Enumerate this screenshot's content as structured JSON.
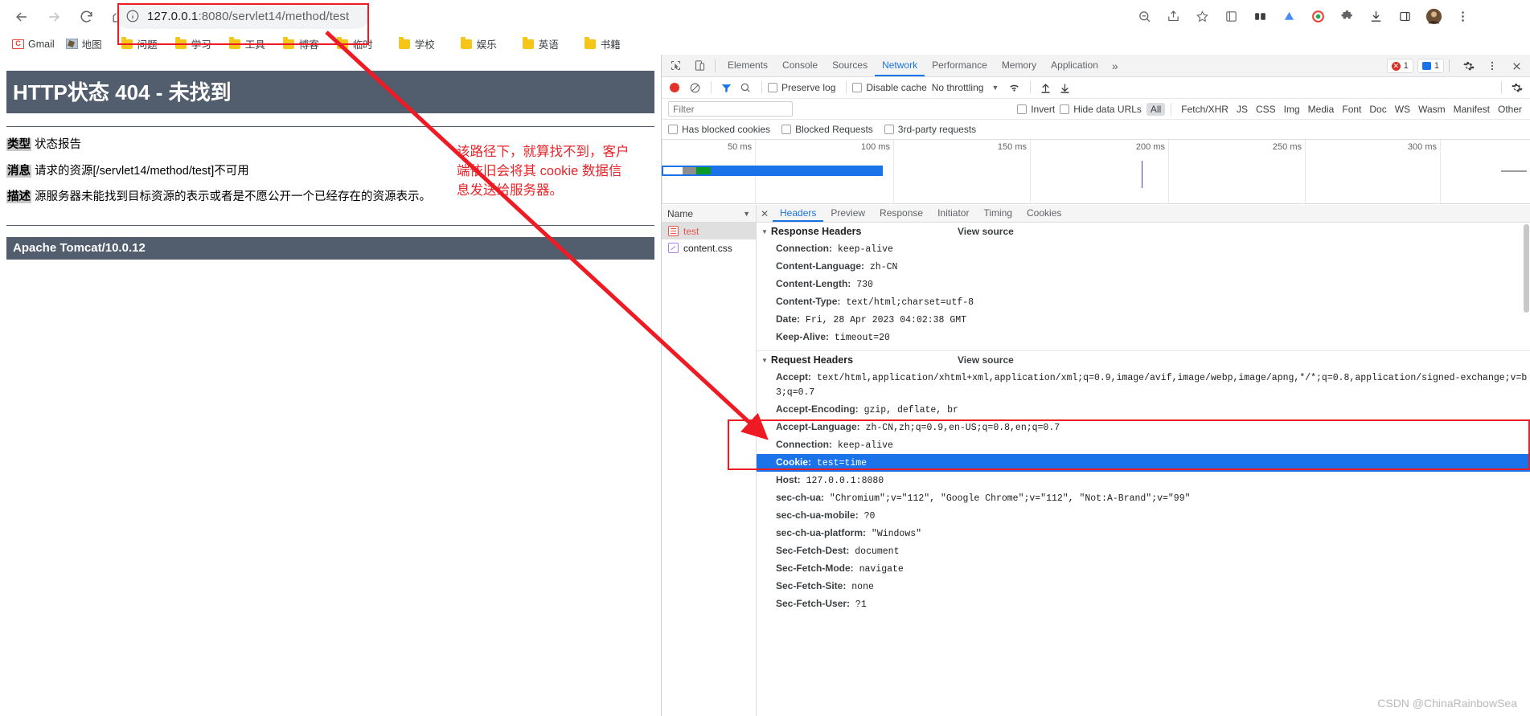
{
  "browser": {
    "nav": {
      "back": "back-arrow",
      "forward": "forward-arrow",
      "reload": "reload",
      "home": "home"
    },
    "omnibox": {
      "host": "127.0.0.1",
      "port": ":8080",
      "path": "/servlet14/method/test",
      "full_url": "127.0.0.1:8080/servlet14/method/test",
      "site_info_icon": "info-circle-icon"
    },
    "toolbar_icons": [
      "zoom-icon",
      "share-icon",
      "bookmark-star-icon",
      "reading-list-icon",
      "extension-grid-icon",
      "cloud-icon",
      "circle-icon",
      "puzzle-icon",
      "download-icon",
      "sidepanel-icon",
      "profile-avatar",
      "three-dot-menu-icon"
    ],
    "bookmarks": [
      {
        "label": "Gmail",
        "icon": "gmail-icon"
      },
      {
        "label": "地图",
        "icon": "map-icon"
      },
      {
        "label": "问题",
        "icon": "folder-icon"
      },
      {
        "label": "学习",
        "icon": "folder-icon"
      },
      {
        "label": "工具",
        "icon": "folder-icon"
      },
      {
        "label": "博客",
        "icon": "folder-icon"
      },
      {
        "label": "临时",
        "icon": "folder-icon"
      },
      {
        "label": "学校",
        "icon": "folder-icon"
      },
      {
        "label": "娱乐",
        "icon": "folder-icon"
      },
      {
        "label": "英语",
        "icon": "folder-icon"
      },
      {
        "label": "书籍",
        "icon": "folder-icon"
      }
    ]
  },
  "page": {
    "title": "HTTP状态 404 - 未找到",
    "rows": [
      {
        "label": "类型",
        "text": " 状态报告"
      },
      {
        "label": "消息",
        "text": " 请求的资源[/servlet14/method/test]不可用"
      },
      {
        "label": "描述",
        "text": " 源服务器未能找到目标资源的表示或者是不愿公开一个已经存在的资源表示。"
      }
    ],
    "footer": "Apache Tomcat/10.0.12"
  },
  "annotation": {
    "text": "该路径下，就算找不到，客户端依旧会将其 cookie 数据信息发送给服务器。",
    "color": "#e8252a"
  },
  "devtools": {
    "tabs": [
      {
        "label": "Elements",
        "active": false
      },
      {
        "label": "Console",
        "active": false
      },
      {
        "label": "Sources",
        "active": false
      },
      {
        "label": "Network",
        "active": true
      },
      {
        "label": "Performance",
        "active": false
      },
      {
        "label": "Memory",
        "active": false
      },
      {
        "label": "Application",
        "active": false
      }
    ],
    "more_tabs": "»",
    "error_count": "1",
    "message_count": "1",
    "settings_icon": "gear-icon",
    "menu_icon": "three-dot-menu-icon",
    "close_icon": "close-icon",
    "inspect_icon": "inspect-element-icon",
    "device_icon": "device-toolbar-icon",
    "toolbar2": {
      "record_icon": "record-button",
      "clear_icon": "clear-icon",
      "filter_icon": "filter-funnel-icon",
      "search_icon": "search-icon",
      "preserve_log": "Preserve log",
      "disable_cache": "Disable cache",
      "throttling": "No throttling",
      "wifi_icon": "network-conditions-icon",
      "import_icon": "import-har-icon",
      "export_icon": "export-har-icon",
      "settings_icon": "network-settings-icon"
    },
    "filterbar": {
      "placeholder": "Filter",
      "value": "",
      "invert": "Invert",
      "hide_data_urls": "Hide data URLs",
      "types": [
        "All",
        "Fetch/XHR",
        "JS",
        "CSS",
        "Img",
        "Media",
        "Font",
        "Doc",
        "WS",
        "Wasm",
        "Manifest",
        "Other"
      ],
      "active_type": "All"
    },
    "filterbar2": {
      "has_blocked_cookies": "Has blocked cookies",
      "blocked_requests": "Blocked Requests",
      "third_party_requests": "3rd-party requests"
    },
    "overview": {
      "ticks": [
        "50 ms",
        "100 ms",
        "150 ms",
        "200 ms",
        "250 ms",
        "300 ms"
      ]
    },
    "requests": {
      "column_header": "Name",
      "sort_icon": "sort-descending-icon",
      "items": [
        {
          "name": "test",
          "icon": "document-icon",
          "selected": true
        },
        {
          "name": "content.css",
          "icon": "stylesheet-icon",
          "selected": false
        }
      ]
    },
    "detail_tabs": [
      {
        "label": "Headers",
        "active": true
      },
      {
        "label": "Preview",
        "active": false
      },
      {
        "label": "Response",
        "active": false
      },
      {
        "label": "Initiator",
        "active": false
      },
      {
        "label": "Timing",
        "active": false
      },
      {
        "label": "Cookies",
        "active": false
      }
    ],
    "view_source": "View source",
    "response_headers": {
      "title": "Response Headers",
      "items": [
        {
          "key": "Connection:",
          "value": " keep-alive"
        },
        {
          "key": "Content-Language:",
          "value": " zh-CN"
        },
        {
          "key": "Content-Length:",
          "value": " 730"
        },
        {
          "key": "Content-Type:",
          "value": " text/html;charset=utf-8"
        },
        {
          "key": "Date:",
          "value": " Fri, 28 Apr 2023 04:02:38 GMT"
        },
        {
          "key": "Keep-Alive:",
          "value": " timeout=20"
        }
      ]
    },
    "request_headers": {
      "title": "Request Headers",
      "items": [
        {
          "key": "Accept:",
          "value": " text/html,application/xhtml+xml,application/xml;q=0.9,image/avif,image/webp,image/apng,*/*;q=0.8,application/signed-exchange;v=b3;q=0.7",
          "highlight": false
        },
        {
          "key": "Accept-Encoding:",
          "value": " gzip, deflate, br",
          "highlight": false
        },
        {
          "key": "Accept-Language:",
          "value": " zh-CN,zh;q=0.9,en-US;q=0.8,en;q=0.7",
          "highlight": false
        },
        {
          "key": "Connection:",
          "value": " keep-alive",
          "highlight": false
        },
        {
          "key": "Cookie:",
          "value": " test=time",
          "highlight": true
        },
        {
          "key": "Host:",
          "value": " 127.0.0.1:8080",
          "highlight": false
        },
        {
          "key": "sec-ch-ua:",
          "value": " \"Chromium\";v=\"112\", \"Google Chrome\";v=\"112\", \"Not:A-Brand\";v=\"99\"",
          "highlight": false
        },
        {
          "key": "sec-ch-ua-mobile:",
          "value": " ?0",
          "highlight": false
        },
        {
          "key": "sec-ch-ua-platform:",
          "value": " \"Windows\"",
          "highlight": false
        },
        {
          "key": "Sec-Fetch-Dest:",
          "value": " document",
          "highlight": false
        },
        {
          "key": "Sec-Fetch-Mode:",
          "value": " navigate",
          "highlight": false
        },
        {
          "key": "Sec-Fetch-Site:",
          "value": " none",
          "highlight": false
        },
        {
          "key": "Sec-Fetch-User:",
          "value": " ?1",
          "highlight": false
        }
      ]
    }
  },
  "watermark": "CSDN @ChinaRainbowSea"
}
